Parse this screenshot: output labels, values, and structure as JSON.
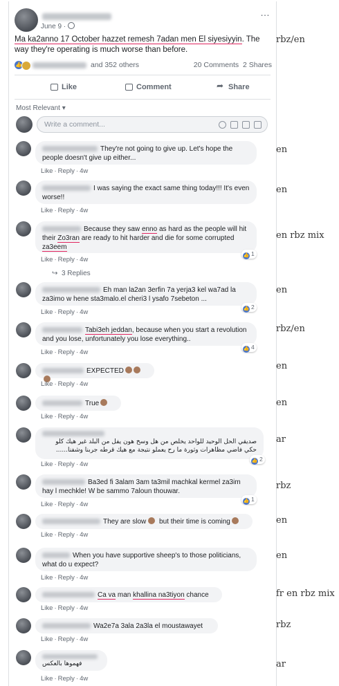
{
  "post": {
    "date": "June 9 ·",
    "more_icon": "…",
    "text_underlined": "Ma ka2anno 17 October hazzet remesh 7adan men El siyesiyyin",
    "text_rest": ". The way they're operating is much worse than before.",
    "reactions_others": "and 352 others",
    "comments_count": "20 Comments",
    "shares_count": "2 Shares"
  },
  "actions": {
    "like": "Like",
    "comment": "Comment",
    "share": "Share"
  },
  "sort_label": "Most Relevant ▾",
  "write_placeholder": "Write a comment...",
  "comments": [
    {
      "parts": [
        "They're not going to give up. Let's hope the people doesn't give up either..."
      ],
      "like": "Like",
      "reply": "Reply",
      "time": "4w",
      "tag": "en"
    },
    {
      "parts": [
        "I was saying the exact same thing today!!! It's even worse!!"
      ],
      "like": "Like",
      "reply": "Reply",
      "time": "4w",
      "tag": "en"
    },
    {
      "parts": [
        "Because they saw ",
        "enno",
        " as hard as the people will hit their ",
        "Zo3ran",
        " are ready to hit harder and die for some corrupted ",
        "za3eem"
      ],
      "like": "Like",
      "reply": "Reply",
      "time": "4w",
      "reactions": "1",
      "replies": "3 Replies",
      "tag": "en rbz mix"
    },
    {
      "parts": [
        "Eh man la2an 3erfin 7a yerja3 kel wa7ad la za3imo w hene sta3malo.el cheri3 l ysafo 7sebeton ..."
      ],
      "like": "Like",
      "reply": "Reply",
      "time": "4w",
      "reactions": "2",
      "tag": "en"
    },
    {
      "parts": [
        "Tabi3eh jeddan",
        ", because when you start a revolution and you lose, unfortunately you lose everything.."
      ],
      "like": "Like",
      "reply": "Reply",
      "time": "4w",
      "reactions": "4",
      "tag": "rbz/en"
    },
    {
      "parts": [
        "EXPECTED"
      ],
      "like": "Like",
      "reply": "Reply",
      "time": "4w",
      "tag": "en"
    },
    {
      "parts": [
        "True"
      ],
      "like": "Like",
      "reply": "Reply",
      "time": "4w",
      "tag": "en"
    },
    {
      "parts": [
        "صديقي الحل الوحيد للواحد يخلص من هل وسخ هون يفل من البلد غير هيك كلو حكي فاضي مظاهرات وثورة ما رح يعملو نتيجة مع هيك قرطه جربنا وشفنا......"
      ],
      "like": "Like",
      "reply": "Reply",
      "time": "4w",
      "reactions": "2",
      "tag": "ar"
    },
    {
      "parts": [
        "Ba3ed fi 3alam 3am ta3mil machkal kermel za3im hay l mechkle! W be sammo 7aloun thouwar."
      ],
      "like": "Like",
      "reply": "Reply",
      "time": "4w",
      "reactions": "1",
      "tag": "rbz"
    },
    {
      "parts": [
        "They are slow",
        " but their time is coming"
      ],
      "like": "Like",
      "reply": "Reply",
      "time": "4w",
      "tag": "en"
    },
    {
      "parts": [
        "When you have supportive sheep's to those politicians, what do u expect?"
      ],
      "like": "Like",
      "reply": "Reply",
      "time": "4w",
      "tag": "en"
    },
    {
      "parts": [
        "Ca va",
        " man ",
        "khallina na3tiyon",
        " chance"
      ],
      "like": "Like",
      "reply": "Reply",
      "time": "4w",
      "tag": "fr en rbz mix"
    },
    {
      "parts": [
        "Wa2e7a 3ala 2a3la el moustawayet"
      ],
      "like": "Like",
      "reply": "Reply",
      "time": "4w",
      "tag": "rbz"
    },
    {
      "parts": [
        "فهموها بالعكس"
      ],
      "like": "Like",
      "reply": "Reply",
      "time": "4w",
      "tag": "ar"
    }
  ]
}
